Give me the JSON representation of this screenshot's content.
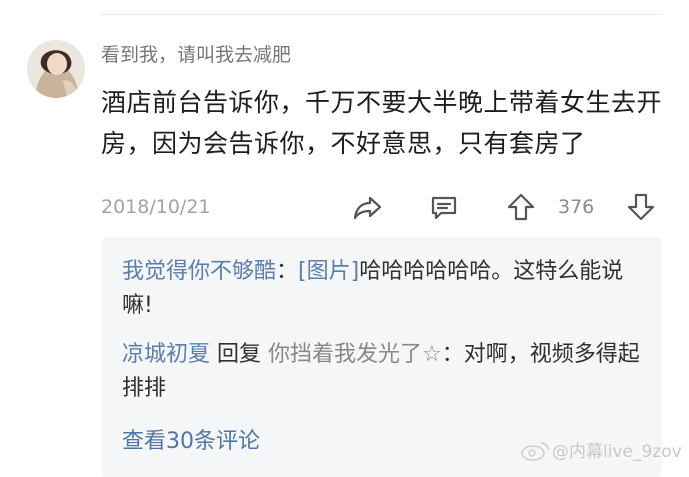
{
  "comment": {
    "username": "看到我，请叫我去减肥",
    "body": "酒店前台告诉你，千万不要大半晚上带着女生去开房，因为会告诉你，不好意思，只有套房了",
    "date": "2018/10/21",
    "vote_count": "376",
    "icons": [
      "share-icon",
      "reply-icon",
      "upvote-icon",
      "downvote-icon"
    ]
  },
  "replies": [
    {
      "author": "我觉得你不够酷",
      "separator": "：",
      "tag": "[图片]",
      "text": "哈哈哈哈哈哈。这特么能说嘛!"
    },
    {
      "author": "凉城初夏",
      "reply_word": " 回复 ",
      "target": "你挡着我发光了☆",
      "separator": "：",
      "text": "对啊，视频多得起排排"
    }
  ],
  "view_more": "查看30条评论",
  "watermark": "@内幕live_9zov",
  "colors": {
    "author_link": "#5b7fa8",
    "muted": "#a3a3a3",
    "panel_bg": "#f5f6f8"
  }
}
